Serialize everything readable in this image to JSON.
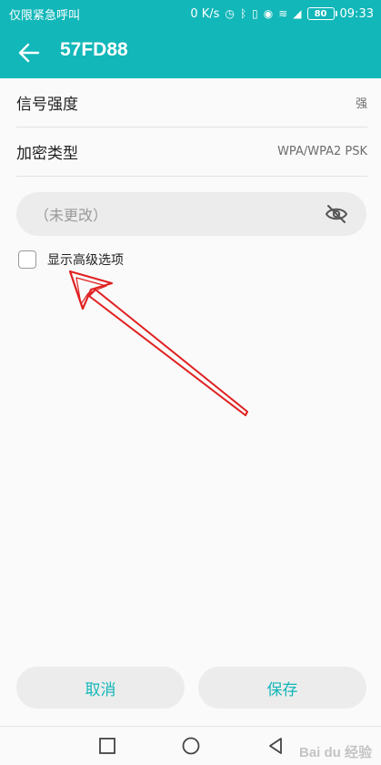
{
  "status_bar": {
    "left_text": "仅限紧急呼叫",
    "speed": "0 K/s",
    "battery": "80",
    "time": "09:33"
  },
  "app_bar": {
    "title": "57FD88",
    "back_icon": "arrow-left-icon"
  },
  "rows": [
    {
      "label": "信号强度",
      "value": "强"
    },
    {
      "label": "加密类型",
      "value": "WPA/WPA2 PSK"
    }
  ],
  "password": {
    "placeholder": "（未更改）",
    "toggle_icon": "eye-off-icon"
  },
  "advanced": {
    "label": "显示高级选项",
    "checked": false
  },
  "buttons": {
    "cancel": "取消",
    "save": "保存"
  },
  "colors": {
    "accent": "#12b7b9",
    "annotation_arrow": "#e02020"
  },
  "watermark": "Bai du 经验"
}
